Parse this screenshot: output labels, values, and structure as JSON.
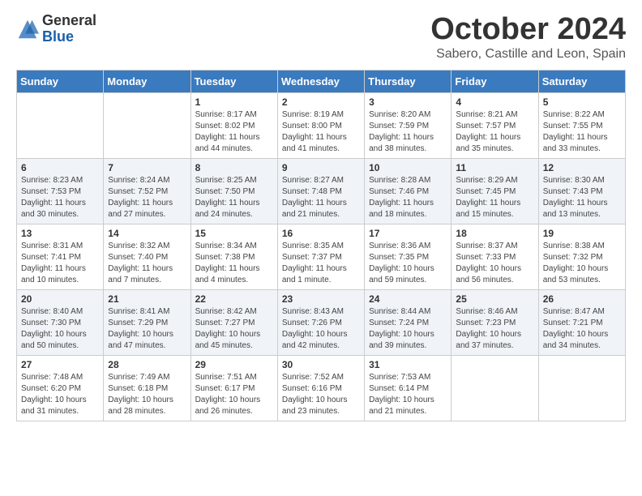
{
  "logo": {
    "general": "General",
    "blue": "Blue"
  },
  "header": {
    "month": "October 2024",
    "location": "Sabero, Castille and Leon, Spain"
  },
  "days_of_week": [
    "Sunday",
    "Monday",
    "Tuesday",
    "Wednesday",
    "Thursday",
    "Friday",
    "Saturday"
  ],
  "weeks": [
    [
      {
        "day": "",
        "content": ""
      },
      {
        "day": "",
        "content": ""
      },
      {
        "day": "1",
        "content": "Sunrise: 8:17 AM\nSunset: 8:02 PM\nDaylight: 11 hours and 44 minutes."
      },
      {
        "day": "2",
        "content": "Sunrise: 8:19 AM\nSunset: 8:00 PM\nDaylight: 11 hours and 41 minutes."
      },
      {
        "day": "3",
        "content": "Sunrise: 8:20 AM\nSunset: 7:59 PM\nDaylight: 11 hours and 38 minutes."
      },
      {
        "day": "4",
        "content": "Sunrise: 8:21 AM\nSunset: 7:57 PM\nDaylight: 11 hours and 35 minutes."
      },
      {
        "day": "5",
        "content": "Sunrise: 8:22 AM\nSunset: 7:55 PM\nDaylight: 11 hours and 33 minutes."
      }
    ],
    [
      {
        "day": "6",
        "content": "Sunrise: 8:23 AM\nSunset: 7:53 PM\nDaylight: 11 hours and 30 minutes."
      },
      {
        "day": "7",
        "content": "Sunrise: 8:24 AM\nSunset: 7:52 PM\nDaylight: 11 hours and 27 minutes."
      },
      {
        "day": "8",
        "content": "Sunrise: 8:25 AM\nSunset: 7:50 PM\nDaylight: 11 hours and 24 minutes."
      },
      {
        "day": "9",
        "content": "Sunrise: 8:27 AM\nSunset: 7:48 PM\nDaylight: 11 hours and 21 minutes."
      },
      {
        "day": "10",
        "content": "Sunrise: 8:28 AM\nSunset: 7:46 PM\nDaylight: 11 hours and 18 minutes."
      },
      {
        "day": "11",
        "content": "Sunrise: 8:29 AM\nSunset: 7:45 PM\nDaylight: 11 hours and 15 minutes."
      },
      {
        "day": "12",
        "content": "Sunrise: 8:30 AM\nSunset: 7:43 PM\nDaylight: 11 hours and 13 minutes."
      }
    ],
    [
      {
        "day": "13",
        "content": "Sunrise: 8:31 AM\nSunset: 7:41 PM\nDaylight: 11 hours and 10 minutes."
      },
      {
        "day": "14",
        "content": "Sunrise: 8:32 AM\nSunset: 7:40 PM\nDaylight: 11 hours and 7 minutes."
      },
      {
        "day": "15",
        "content": "Sunrise: 8:34 AM\nSunset: 7:38 PM\nDaylight: 11 hours and 4 minutes."
      },
      {
        "day": "16",
        "content": "Sunrise: 8:35 AM\nSunset: 7:37 PM\nDaylight: 11 hours and 1 minute."
      },
      {
        "day": "17",
        "content": "Sunrise: 8:36 AM\nSunset: 7:35 PM\nDaylight: 10 hours and 59 minutes."
      },
      {
        "day": "18",
        "content": "Sunrise: 8:37 AM\nSunset: 7:33 PM\nDaylight: 10 hours and 56 minutes."
      },
      {
        "day": "19",
        "content": "Sunrise: 8:38 AM\nSunset: 7:32 PM\nDaylight: 10 hours and 53 minutes."
      }
    ],
    [
      {
        "day": "20",
        "content": "Sunrise: 8:40 AM\nSunset: 7:30 PM\nDaylight: 10 hours and 50 minutes."
      },
      {
        "day": "21",
        "content": "Sunrise: 8:41 AM\nSunset: 7:29 PM\nDaylight: 10 hours and 47 minutes."
      },
      {
        "day": "22",
        "content": "Sunrise: 8:42 AM\nSunset: 7:27 PM\nDaylight: 10 hours and 45 minutes."
      },
      {
        "day": "23",
        "content": "Sunrise: 8:43 AM\nSunset: 7:26 PM\nDaylight: 10 hours and 42 minutes."
      },
      {
        "day": "24",
        "content": "Sunrise: 8:44 AM\nSunset: 7:24 PM\nDaylight: 10 hours and 39 minutes."
      },
      {
        "day": "25",
        "content": "Sunrise: 8:46 AM\nSunset: 7:23 PM\nDaylight: 10 hours and 37 minutes."
      },
      {
        "day": "26",
        "content": "Sunrise: 8:47 AM\nSunset: 7:21 PM\nDaylight: 10 hours and 34 minutes."
      }
    ],
    [
      {
        "day": "27",
        "content": "Sunrise: 7:48 AM\nSunset: 6:20 PM\nDaylight: 10 hours and 31 minutes."
      },
      {
        "day": "28",
        "content": "Sunrise: 7:49 AM\nSunset: 6:18 PM\nDaylight: 10 hours and 28 minutes."
      },
      {
        "day": "29",
        "content": "Sunrise: 7:51 AM\nSunset: 6:17 PM\nDaylight: 10 hours and 26 minutes."
      },
      {
        "day": "30",
        "content": "Sunrise: 7:52 AM\nSunset: 6:16 PM\nDaylight: 10 hours and 23 minutes."
      },
      {
        "day": "31",
        "content": "Sunrise: 7:53 AM\nSunset: 6:14 PM\nDaylight: 10 hours and 21 minutes."
      },
      {
        "day": "",
        "content": ""
      },
      {
        "day": "",
        "content": ""
      }
    ]
  ]
}
